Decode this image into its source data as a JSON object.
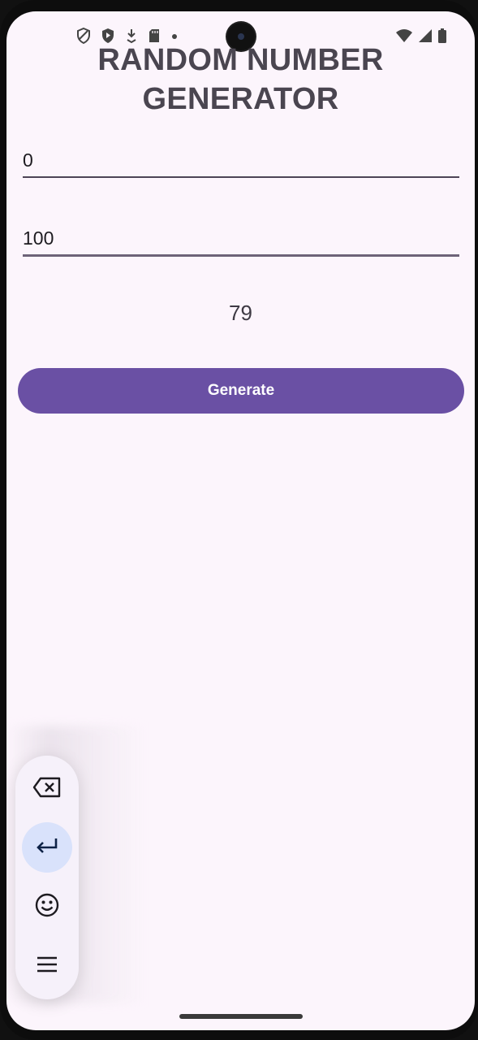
{
  "app": {
    "title": "RANDOM NUMBER GENERATOR"
  },
  "form": {
    "min_value": "0",
    "max_value": "100"
  },
  "result": {
    "value": "79"
  },
  "actions": {
    "generate_label": "Generate"
  },
  "floating_toolbar": {
    "buttons": [
      "backspace-icon",
      "enter-icon",
      "emoji-icon",
      "menu-icon"
    ]
  },
  "colors": {
    "background": "#fcf5fc",
    "primary": "#6a50a4",
    "title": "#4a4550",
    "toolbar_active": "#d9e2fb"
  }
}
